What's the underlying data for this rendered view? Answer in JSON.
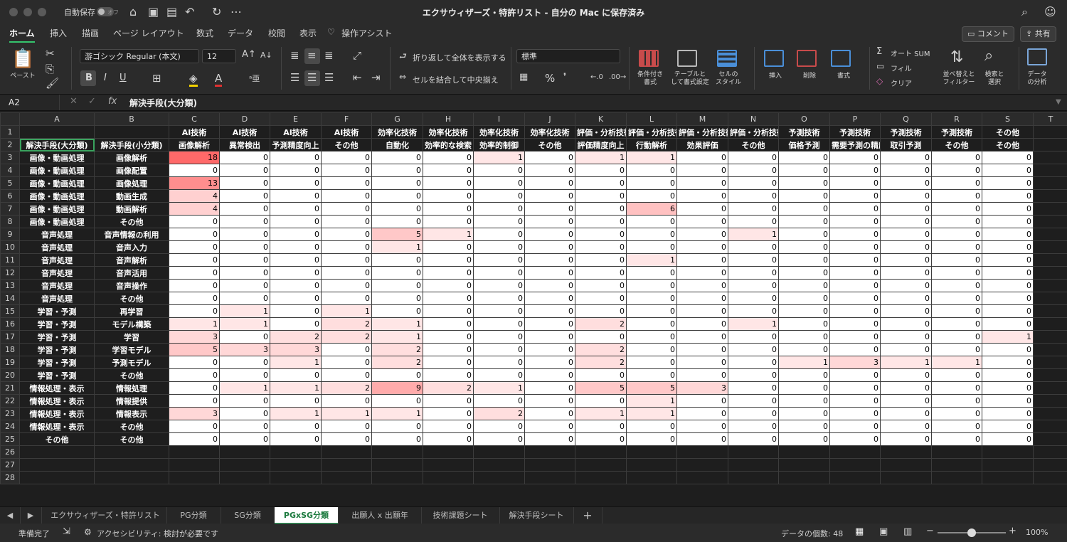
{
  "titlebar": {
    "autosave_label": "自動保存",
    "autosave_state": "オフ",
    "doc_title": "エクサウィザーズ・特許リスト - 自分の Mac に保存済み",
    "icons": [
      "home-icon",
      "save-icon",
      "save-as-icon",
      "undo-icon",
      "redo-icon",
      "more-icon",
      "search-icon",
      "account-icon"
    ]
  },
  "menu": {
    "tabs": [
      "ホーム",
      "挿入",
      "描画",
      "ページ レイアウト",
      "数式",
      "データ",
      "校閲",
      "表示"
    ],
    "assist": "操作アシスト",
    "comment_button": "コメント",
    "share_button": "共有"
  },
  "ribbon": {
    "paste_label": "ペースト",
    "font_name": "游ゴシック Regular (本文)",
    "font_size": "12",
    "bold": "B",
    "italic": "I",
    "underline": "U",
    "wrap_text": "折り返して全体を表示する",
    "merge_center": "セルを結合して中央揃え",
    "number_format": "標準",
    "percent": "%",
    "conditional_format": "条件付き\n書式",
    "format_as_table": "テーブルと\nして書式設定",
    "cell_styles": "セルの\nスタイル",
    "insert": "挿入",
    "delete": "削除",
    "format": "書式",
    "autosum": "オート SUM",
    "fill": "フィル",
    "clear": "クリア",
    "sort_filter": "並べ替えと\nフィルター",
    "find_select": "検索と\n選択",
    "analyze_data": "データ\nの分析"
  },
  "formula_bar": {
    "name_box": "A2",
    "formula": "解決手段(大分類)"
  },
  "sheet": {
    "columns": [
      "A",
      "B",
      "C",
      "D",
      "E",
      "F",
      "G",
      "H",
      "I",
      "J",
      "K",
      "L",
      "M",
      "N",
      "O",
      "P",
      "Q",
      "R",
      "S",
      "T"
    ],
    "row1": [
      "",
      "",
      "AI技術",
      "AI技術",
      "AI技術",
      "AI技術",
      "効率化技術",
      "効率化技術",
      "効率化技術",
      "効率化技術",
      "評価・分析技術",
      "評価・分析技術",
      "評価・分析技術",
      "評価・分析技術",
      "予測技術",
      "予測技術",
      "予測技術",
      "予測技術",
      "その他"
    ],
    "row2": [
      "解決手段(大分類)",
      "解決手段(小分類)",
      "画像解析",
      "異常検出",
      "予測精度向上",
      "その他",
      "自動化",
      "効率的な検索",
      "効率的制御",
      "その他",
      "評価精度向上",
      "行動解析",
      "効果評価",
      "その他",
      "価格予測",
      "需要予測の精度",
      "取引予測",
      "その他",
      "その他"
    ],
    "data_rows": [
      {
        "a": "画像・動画処理",
        "b": "画像解析",
        "v": [
          18,
          0,
          0,
          0,
          0,
          0,
          1,
          0,
          1,
          1,
          0,
          0,
          0,
          0,
          0,
          0,
          0
        ]
      },
      {
        "a": "画像・動画処理",
        "b": "画像配置",
        "v": [
          0,
          0,
          0,
          0,
          0,
          0,
          0,
          0,
          0,
          0,
          0,
          0,
          0,
          0,
          0,
          0,
          0
        ]
      },
      {
        "a": "画像・動画処理",
        "b": "画像処理",
        "v": [
          13,
          0,
          0,
          0,
          0,
          0,
          0,
          0,
          0,
          0,
          0,
          0,
          0,
          0,
          0,
          0,
          0
        ]
      },
      {
        "a": "画像・動画処理",
        "b": "動画生成",
        "v": [
          4,
          0,
          0,
          0,
          0,
          0,
          0,
          0,
          0,
          0,
          0,
          0,
          0,
          0,
          0,
          0,
          0
        ]
      },
      {
        "a": "画像・動画処理",
        "b": "動画解析",
        "v": [
          4,
          0,
          0,
          0,
          0,
          0,
          0,
          0,
          0,
          6,
          0,
          0,
          0,
          0,
          0,
          0,
          0
        ]
      },
      {
        "a": "画像・動画処理",
        "b": "その他",
        "v": [
          0,
          0,
          0,
          0,
          0,
          0,
          0,
          0,
          0,
          0,
          0,
          0,
          0,
          0,
          0,
          0,
          0
        ]
      },
      {
        "a": "音声処理",
        "b": "音声情報の利用",
        "v": [
          0,
          0,
          0,
          0,
          5,
          1,
          0,
          0,
          0,
          0,
          0,
          1,
          0,
          0,
          0,
          0,
          0
        ]
      },
      {
        "a": "音声処理",
        "b": "音声入力",
        "v": [
          0,
          0,
          0,
          0,
          1,
          0,
          0,
          0,
          0,
          0,
          0,
          0,
          0,
          0,
          0,
          0,
          0
        ]
      },
      {
        "a": "音声処理",
        "b": "音声解析",
        "v": [
          0,
          0,
          0,
          0,
          0,
          0,
          0,
          0,
          0,
          1,
          0,
          0,
          0,
          0,
          0,
          0,
          0
        ]
      },
      {
        "a": "音声処理",
        "b": "音声活用",
        "v": [
          0,
          0,
          0,
          0,
          0,
          0,
          0,
          0,
          0,
          0,
          0,
          0,
          0,
          0,
          0,
          0,
          0
        ]
      },
      {
        "a": "音声処理",
        "b": "音声操作",
        "v": [
          0,
          0,
          0,
          0,
          0,
          0,
          0,
          0,
          0,
          0,
          0,
          0,
          0,
          0,
          0,
          0,
          0
        ]
      },
      {
        "a": "音声処理",
        "b": "その他",
        "v": [
          0,
          0,
          0,
          0,
          0,
          0,
          0,
          0,
          0,
          0,
          0,
          0,
          0,
          0,
          0,
          0,
          0
        ]
      },
      {
        "a": "学習・予測",
        "b": "再学習",
        "v": [
          0,
          1,
          0,
          1,
          0,
          0,
          0,
          0,
          0,
          0,
          0,
          0,
          0,
          0,
          0,
          0,
          0
        ]
      },
      {
        "a": "学習・予測",
        "b": "モデル構築",
        "v": [
          1,
          1,
          0,
          2,
          1,
          0,
          0,
          0,
          2,
          0,
          0,
          1,
          0,
          0,
          0,
          0,
          0
        ]
      },
      {
        "a": "学習・予測",
        "b": "学習",
        "v": [
          3,
          0,
          2,
          2,
          1,
          0,
          0,
          0,
          0,
          0,
          0,
          0,
          0,
          0,
          0,
          0,
          1
        ]
      },
      {
        "a": "学習・予測",
        "b": "学習モデル",
        "v": [
          5,
          3,
          3,
          0,
          2,
          0,
          0,
          0,
          2,
          0,
          0,
          0,
          0,
          0,
          0,
          0,
          0
        ]
      },
      {
        "a": "学習・予測",
        "b": "予測モデル",
        "v": [
          0,
          0,
          1,
          0,
          2,
          0,
          0,
          0,
          2,
          0,
          0,
          0,
          1,
          3,
          1,
          1,
          0
        ]
      },
      {
        "a": "学習・予測",
        "b": "その他",
        "v": [
          0,
          0,
          0,
          0,
          0,
          0,
          0,
          0,
          0,
          0,
          0,
          0,
          0,
          0,
          0,
          0,
          0
        ]
      },
      {
        "a": "情報処理・表示",
        "b": "情報処理",
        "v": [
          0,
          1,
          1,
          2,
          9,
          2,
          1,
          0,
          5,
          5,
          3,
          0,
          0,
          0,
          0,
          0,
          0
        ]
      },
      {
        "a": "情報処理・表示",
        "b": "情報提供",
        "v": [
          0,
          0,
          0,
          0,
          0,
          0,
          0,
          0,
          0,
          1,
          0,
          0,
          0,
          0,
          0,
          0,
          0
        ]
      },
      {
        "a": "情報処理・表示",
        "b": "情報表示",
        "v": [
          3,
          0,
          1,
          1,
          1,
          0,
          2,
          0,
          1,
          1,
          0,
          0,
          0,
          0,
          0,
          0,
          0
        ]
      },
      {
        "a": "情報処理・表示",
        "b": "その他",
        "v": [
          0,
          0,
          0,
          0,
          0,
          0,
          0,
          0,
          0,
          0,
          0,
          0,
          0,
          0,
          0,
          0,
          0
        ]
      },
      {
        "a": "その他",
        "b": "その他",
        "v": [
          0,
          0,
          0,
          0,
          0,
          0,
          0,
          0,
          0,
          0,
          0,
          0,
          0,
          0,
          0,
          0,
          0
        ]
      }
    ],
    "heat_color": "#f26b6b"
  },
  "sheet_tabs": [
    "エクサウィザーズ・特許リスト",
    "PG分類",
    "SG分類",
    "PGxSG分類",
    "出願人 x 出願年",
    "技術課題シート",
    "解決手段シート"
  ],
  "active_sheet_tab": "PGxSG分類",
  "status": {
    "ready": "準備完了",
    "accessibility": "アクセシビリティ: 検討が必要です",
    "count": "データの個数: 48",
    "zoom": "100%",
    "zoom_level": 0.5
  }
}
